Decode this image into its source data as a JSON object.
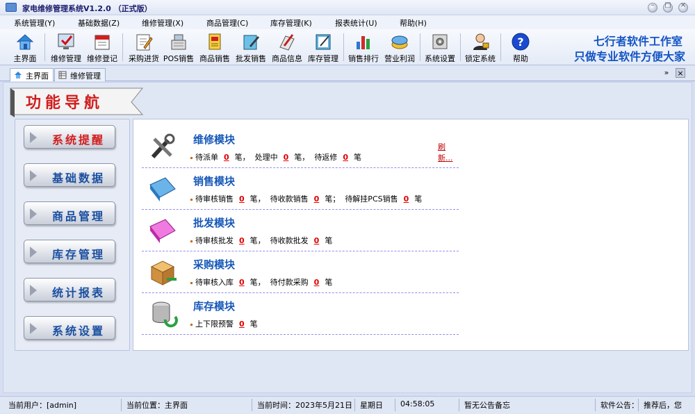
{
  "window": {
    "title": "家电维修管理系统V1.2.0 （正式版）"
  },
  "menu": [
    "系统管理(Y)",
    "基础数据(Z)",
    "维修管理(X)",
    "商品管理(C)",
    "库存管理(K)",
    "报表统计(U)",
    "帮助(H)"
  ],
  "toolbar": {
    "home": "主界面",
    "repair_manage": "维修管理",
    "repair_register": "维修登记",
    "purchase": "采购进货",
    "pos_sale": "POS销售",
    "goods_sale": "商品销售",
    "wholesale": "批发销售",
    "goods_info": "商品信息",
    "stock_manage": "库存管理",
    "sales_rank": "销售排行",
    "profit": "营业利润",
    "settings": "系统设置",
    "lock": "锁定系统",
    "help": "帮助"
  },
  "brand": {
    "line1": "七行者软件工作室",
    "line2": "只做专业软件方便大家"
  },
  "tabs": {
    "home": "主界面",
    "repair": "维修管理",
    "pin": "»",
    "close": "×"
  },
  "nav": {
    "banner": "功能导航",
    "buttons": [
      "系统提醒",
      "基础数据",
      "商品管理",
      "库存管理",
      "统计报表",
      "系统设置"
    ]
  },
  "refresh": "刷新...",
  "modules": [
    {
      "title": "维修模块",
      "parts": [
        {
          "label": "待派单",
          "value": "0",
          "tail": "笔，"
        },
        {
          "label": "处理中",
          "value": "0",
          "tail": "笔，"
        },
        {
          "label": "待返修",
          "value": "0",
          "tail": "笔"
        }
      ]
    },
    {
      "title": "销售模块",
      "parts": [
        {
          "label": "待审核销售",
          "value": "0",
          "tail": "笔，"
        },
        {
          "label": "待收款销售",
          "value": "0",
          "tail": "笔；"
        },
        {
          "label": "待解挂PCS销售",
          "value": "0",
          "tail": "笔"
        }
      ]
    },
    {
      "title": "批发模块",
      "parts": [
        {
          "label": "待审核批发",
          "value": "0",
          "tail": "笔，"
        },
        {
          "label": "待收款批发",
          "value": "0",
          "tail": "笔"
        }
      ]
    },
    {
      "title": "采购模块",
      "parts": [
        {
          "label": "待审核入库",
          "value": "0",
          "tail": "笔，"
        },
        {
          "label": "待付款采购",
          "value": "0",
          "tail": "笔"
        }
      ]
    },
    {
      "title": "库存模块",
      "parts": [
        {
          "label": "上下限预警",
          "value": "0",
          "tail": "笔"
        }
      ]
    }
  ],
  "status": {
    "user": "当前用户：[admin]",
    "location": "当前位置：主界面",
    "time": "当前时间：2023年5月21日",
    "weekday": "星期日",
    "clock": "04:58:05",
    "notice": "暂无公告备忘",
    "announce_label": "软件公告：",
    "announce": "推荐后，您"
  }
}
